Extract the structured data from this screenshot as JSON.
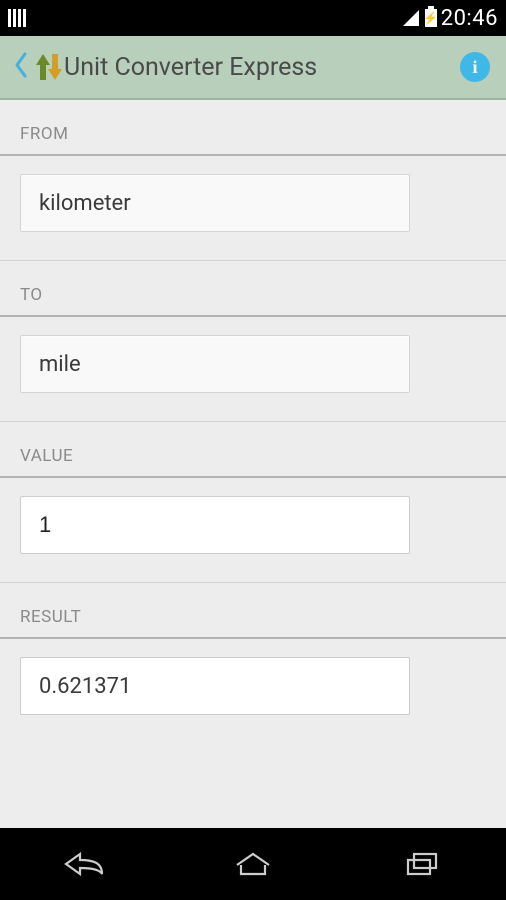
{
  "status": {
    "time": "20:46"
  },
  "appbar": {
    "title": "Unit Converter Express"
  },
  "sections": {
    "from": {
      "label": "FROM",
      "value": "kilometer"
    },
    "to": {
      "label": "TO",
      "value": "mile"
    },
    "value": {
      "label": "VALUE",
      "value": "1"
    },
    "result": {
      "label": "RESULT",
      "value": "0.621371"
    }
  }
}
